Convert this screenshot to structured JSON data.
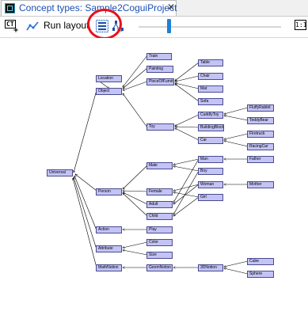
{
  "tab": {
    "title": "Concept types: Sample2CoguiProject",
    "close": "✕",
    "icon": "app-icon"
  },
  "toolbar": {
    "ct_label": "CT",
    "ct_plus": "+",
    "run_label": "Run layout",
    "zoom_reset": "1:1",
    "zoom_level": 0.2,
    "highlight_color": "#e8101a",
    "accent_color": "#1e7fd8"
  },
  "graph": {
    "node_color": "#c3c3f5",
    "nodes": {
      "train": "Train",
      "painting": "Painting",
      "location": "Location",
      "pieceoffurniture": "PieceOfFurnitu",
      "table": "Table",
      "chair": "Chair",
      "mat": "Mat",
      "sofa": "Sofa",
      "object": "Object",
      "fluffyrabbit": "FluffyRabbit",
      "teddybear": "TeddyBear",
      "cuddlytoy": "CuddlyToy",
      "toy": "Toy",
      "buildingblock": "BuildingBlock",
      "firetruck": "Firetruck",
      "car": "Car",
      "racingcar": "RacingCar",
      "man": "Man",
      "father": "Father",
      "male": "Male",
      "boy": "Boy",
      "universal": "Universal",
      "person": "Person",
      "female": "Female",
      "woman": "Woman",
      "mother": "Mother",
      "adult": "Adult",
      "girl": "Girl",
      "child": "Child",
      "action": "Action",
      "play": "Play",
      "color": "Color",
      "attribute": "Attribute",
      "size": "Size",
      "cube": "Cube",
      "mathnotion": "MathNotion",
      "geomnotion": "GeomNotion",
      "3dnotion": "3DNotion",
      "sphere": "Sphere"
    }
  }
}
